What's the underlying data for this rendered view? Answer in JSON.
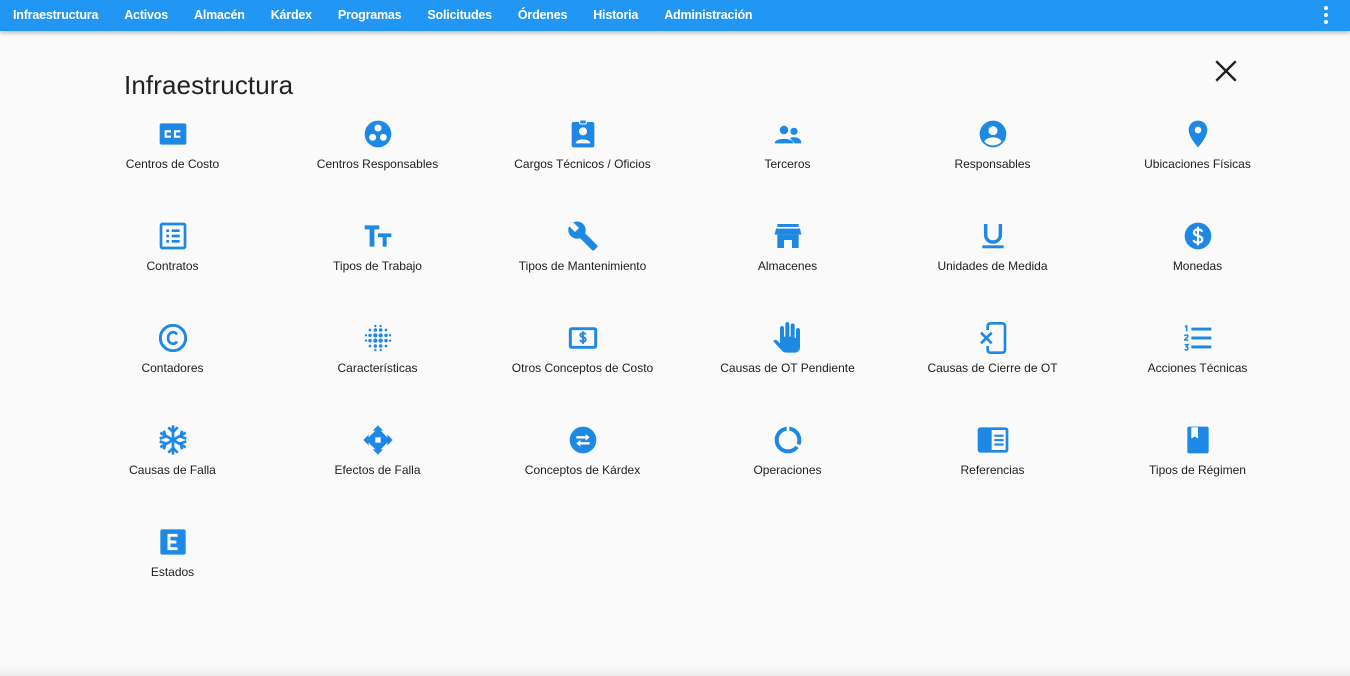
{
  "nav": {
    "items": [
      "Infraestructura",
      "Activos",
      "Almacén",
      "Kárdex",
      "Programas",
      "Solicitudes",
      "Órdenes",
      "Historia",
      "Administración"
    ]
  },
  "header": {
    "title": "Infraestructura"
  },
  "tiles": [
    {
      "label": "Centros de Costo",
      "icon": "cc-icon"
    },
    {
      "label": "Centros Responsables",
      "icon": "group-circle-icon"
    },
    {
      "label": "Cargos Técnicos / Oficios",
      "icon": "badge-icon"
    },
    {
      "label": "Terceros",
      "icon": "people-icon"
    },
    {
      "label": "Responsables",
      "icon": "account-circle-icon"
    },
    {
      "label": "Ubicaciones Físicas",
      "icon": "location-pin-icon"
    },
    {
      "label": "Contratos",
      "icon": "list-alt-icon"
    },
    {
      "label": "Tipos de Trabajo",
      "icon": "text-size-icon"
    },
    {
      "label": "Tipos de Mantenimiento",
      "icon": "wrench-icon"
    },
    {
      "label": "Almacenes",
      "icon": "store-icon"
    },
    {
      "label": "Unidades de Medida",
      "icon": "underline-icon"
    },
    {
      "label": "Monedas",
      "icon": "dollar-circle-icon"
    },
    {
      "label": "Contadores",
      "icon": "copyright-icon"
    },
    {
      "label": "Características",
      "icon": "blur-dots-icon"
    },
    {
      "label": "Otros Conceptos de Costo",
      "icon": "money-icon"
    },
    {
      "label": "Causas de OT Pendiente",
      "icon": "hand-icon"
    },
    {
      "label": "Causas de Cierre de OT",
      "icon": "phone-erase-icon"
    },
    {
      "label": "Acciones Técnicas",
      "icon": "numbered-list-icon"
    },
    {
      "label": "Causas de Falla",
      "icon": "snowflake-icon"
    },
    {
      "label": "Efectos de Falla",
      "icon": "move-arrows-icon"
    },
    {
      "label": "Conceptos de Kárdex",
      "icon": "swap-circle-icon"
    },
    {
      "label": "Operaciones",
      "icon": "donut-icon"
    },
    {
      "label": "Referencias",
      "icon": "chrome-reader-icon"
    },
    {
      "label": "Tipos de Régimen",
      "icon": "book-icon"
    },
    {
      "label": "Estados",
      "icon": "letter-e-icon"
    }
  ],
  "colors": {
    "topbar": "#2196f3",
    "icon": "#1e88e5",
    "background": "#fafafa"
  }
}
